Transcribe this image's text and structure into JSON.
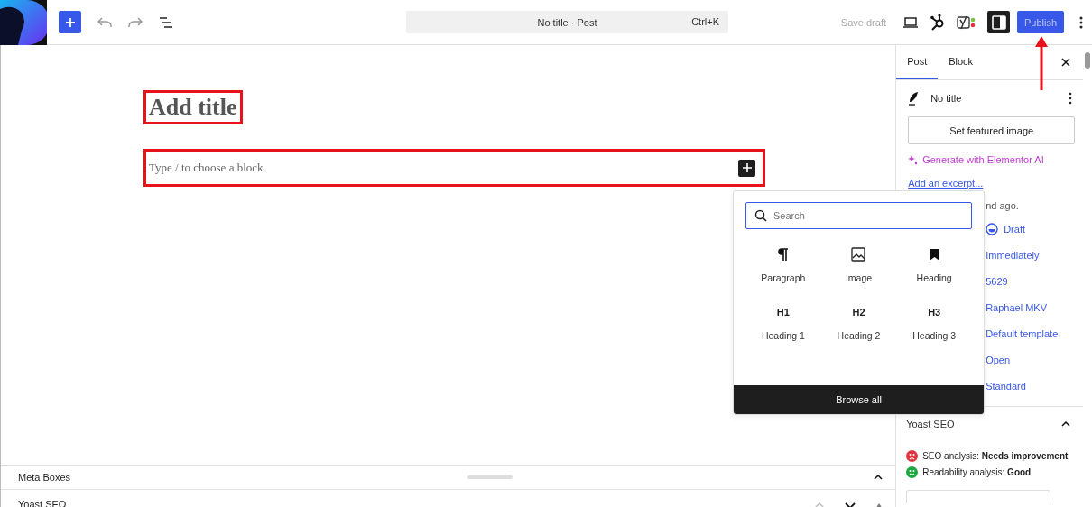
{
  "topbar": {
    "command_bar": {
      "title": "No title · Post",
      "shortcut": "Ctrl+K"
    },
    "save_draft": "Save draft",
    "settings_panel_open": true,
    "publish": "Publish"
  },
  "editor": {
    "title_placeholder": "Add title",
    "block_placeholder": "Type / to choose a block"
  },
  "inserter": {
    "search_placeholder": "Search",
    "blocks": [
      {
        "kind": "paragraph",
        "label": "Paragraph"
      },
      {
        "kind": "image",
        "label": "Image"
      },
      {
        "kind": "bookmark",
        "label": "Heading"
      },
      {
        "kind": "text",
        "icon_text": "H1",
        "label": "Heading 1"
      },
      {
        "kind": "text",
        "icon_text": "H2",
        "label": "Heading 2"
      },
      {
        "kind": "text",
        "icon_text": "H3",
        "label": "Heading 3"
      }
    ],
    "browse_all": "Browse all"
  },
  "sidebar": {
    "tabs": [
      {
        "label": "Post",
        "selected": true
      },
      {
        "label": "Block",
        "selected": false
      }
    ],
    "post_title": "No title",
    "featured_image_button": "Set featured image",
    "ai_link": "Generate with Elementor AI",
    "excerpt_link": "Add an excerpt...",
    "rows": [
      {
        "kind": "text",
        "value": "nd ago."
      },
      {
        "kind": "status",
        "value": "Draft"
      },
      {
        "kind": "link",
        "value": "Immediately"
      },
      {
        "kind": "link",
        "value": "5629"
      },
      {
        "kind": "link",
        "value": "Raphael MKV"
      },
      {
        "kind": "link",
        "value": "Default template"
      },
      {
        "kind": "link",
        "value": "Open"
      },
      {
        "kind": "link",
        "value": "Standard"
      }
    ],
    "yoast": {
      "title": "Yoast SEO",
      "analyses": [
        {
          "text": "SEO analysis: **Needs improvement**",
          "color": "#e0343f"
        },
        {
          "text": "Readability analysis: **Good**",
          "color": "#1ea640"
        }
      ]
    }
  },
  "meta_boxes": {
    "title": "Meta Boxes",
    "panels": [
      {
        "title": "Yoast SEO"
      }
    ]
  }
}
